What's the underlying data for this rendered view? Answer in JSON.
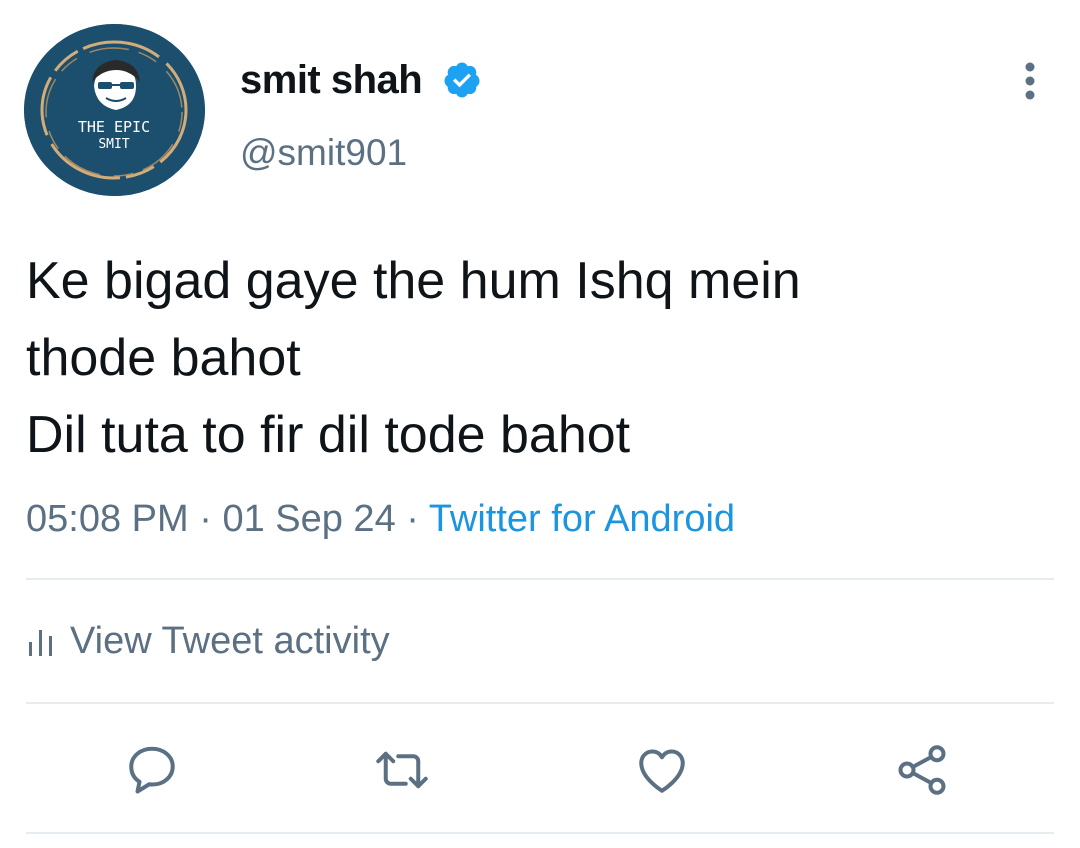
{
  "user": {
    "display_name": "smit shah",
    "handle": "@smit901",
    "avatar_text_line1": "THE EPIC",
    "avatar_text_line2": "SMIT",
    "verified": true
  },
  "tweet": {
    "lines": [
      "Ke bigad gaye the hum Ishq mein",
      "thode bahot",
      "Dil tuta to fir dil tode bahot"
    ],
    "time": "05:08 PM",
    "date": "01 Sep 24",
    "separator": "·",
    "source": "Twitter for Android"
  },
  "activity": {
    "label": "View Tweet activity"
  },
  "icons": {
    "more": "more-vertical-icon",
    "activity": "bar-chart-icon",
    "reply": "reply-icon",
    "retweet": "retweet-icon",
    "like": "heart-icon",
    "share": "share-icon",
    "verified": "verified-badge-icon"
  },
  "colors": {
    "text": "#0f1419",
    "secondary": "#5b7083",
    "accent": "#1b95e0",
    "verified": "#1da1f2",
    "avatar_bg": "#1c4f6e",
    "avatar_ring": "#e8b77a"
  }
}
